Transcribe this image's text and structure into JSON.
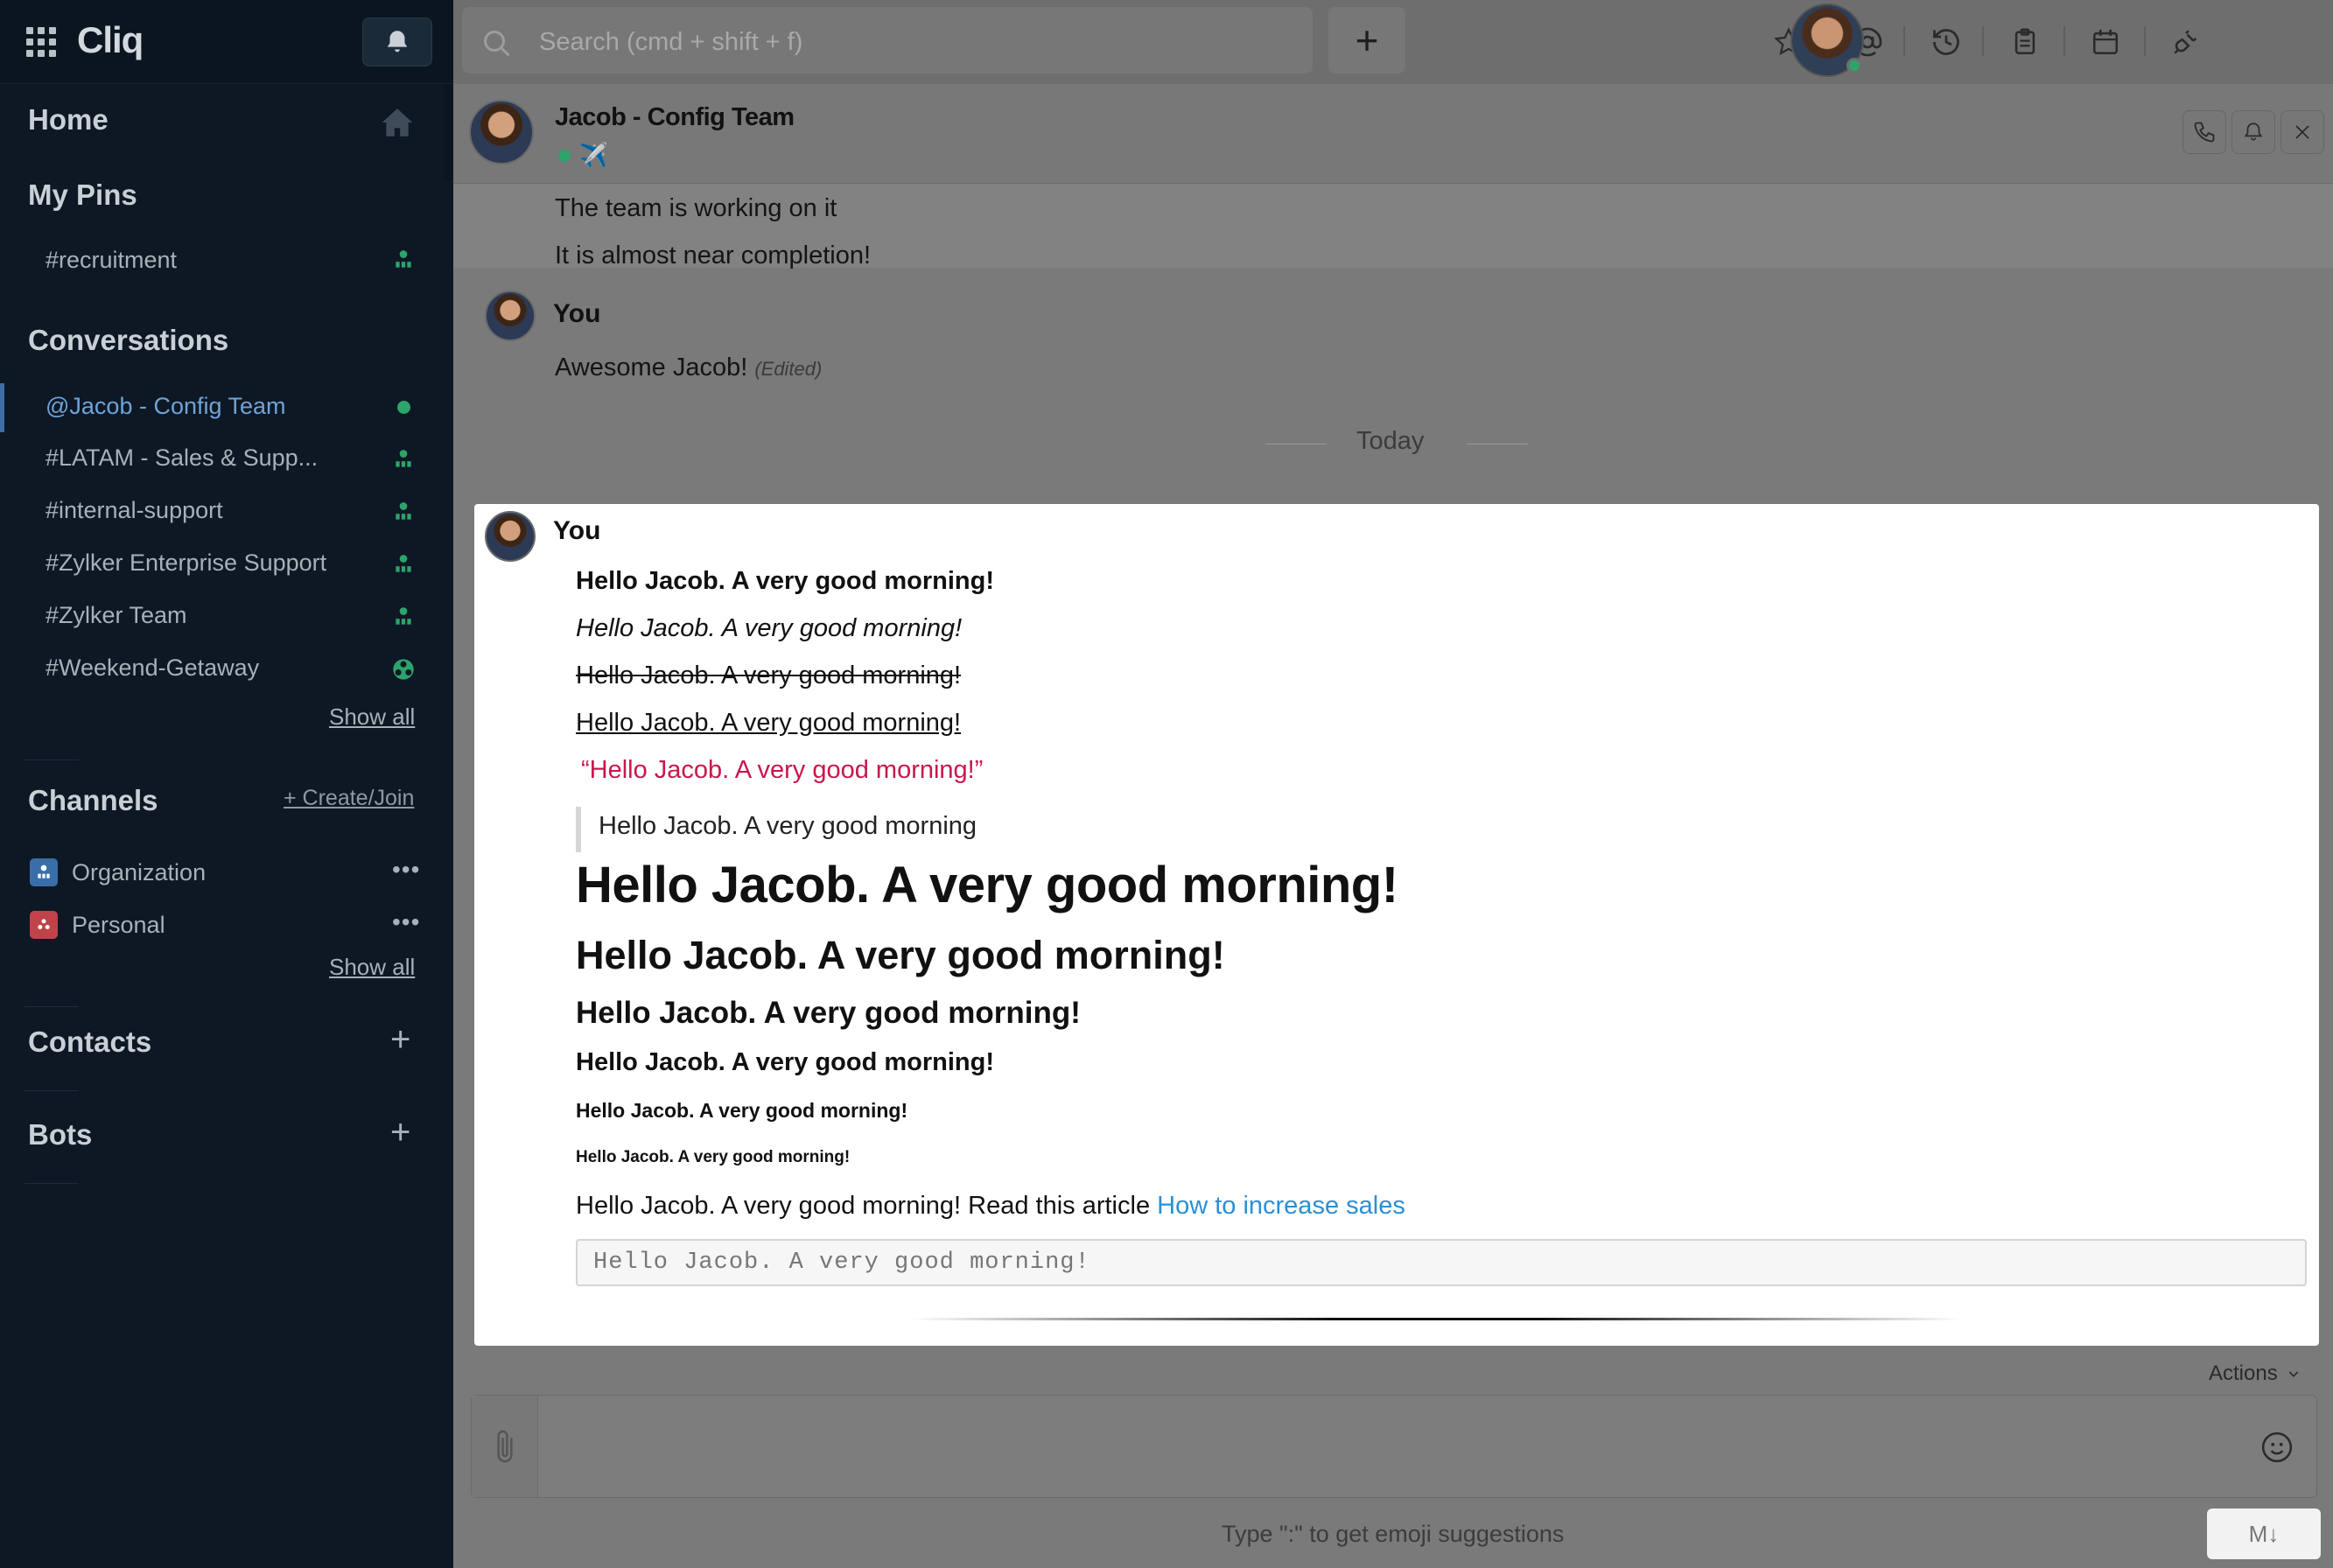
{
  "app": {
    "name": "Cliq"
  },
  "sidebar": {
    "home_label": "Home",
    "pins": {
      "title": "My Pins",
      "items": [
        {
          "label": "#recruitment",
          "icon": "org-icon"
        }
      ]
    },
    "conversations": {
      "title": "Conversations",
      "items": [
        {
          "label": "@Jacob - Config Team",
          "icon": "online-dot",
          "active": true
        },
        {
          "label": "#LATAM - Sales & Supp...",
          "icon": "org-icon"
        },
        {
          "label": "#internal-support",
          "icon": "org-icon"
        },
        {
          "label": "#Zylker Enterprise Support",
          "icon": "org-icon"
        },
        {
          "label": "#Zylker Team",
          "icon": "org-icon"
        },
        {
          "label": "#Weekend-Getaway",
          "icon": "personal-icon"
        }
      ],
      "show_all": "Show all"
    },
    "channels": {
      "title": "Channels",
      "create_join": "+ Create/Join",
      "items": [
        {
          "label": "Organization",
          "badge_color": "#3a6ea8"
        },
        {
          "label": "Personal",
          "badge_color": "#c0434a"
        }
      ],
      "show_all": "Show all"
    },
    "contacts_title": "Contacts",
    "bots_title": "Bots"
  },
  "topbar": {
    "search_placeholder": "Search (cmd + shift + f)",
    "add_label": "+",
    "icons": [
      "star-icon",
      "mention-icon",
      "history-icon",
      "clipboard-icon",
      "calendar-icon",
      "plug-icon"
    ]
  },
  "chat": {
    "contact_name": "Jacob - Config Team",
    "status_emoji": "✈️",
    "earlier_messages": [
      "The team is working on it",
      "It is almost near completion!"
    ],
    "you_label": "You",
    "reply_text": "Awesome Jacob!",
    "edited_label": "(Edited)",
    "date_divider": "Today",
    "formatted_message": {
      "sender": "You",
      "bold": "Hello Jacob. A very good morning!",
      "italic": "Hello Jacob. A very good morning!",
      "strike": "Hello Jacob. A very good morning!",
      "underline": "Hello Jacob. A very good morning!",
      "highlight": "“Hello Jacob. A very good morning!”",
      "blockquote": "Hello Jacob. A very good morning",
      "h1": "Hello Jacob. A very good morning!",
      "h2": "Hello Jacob. A very good morning!",
      "h3": "Hello Jacob. A very good morning!",
      "h4": "Hello Jacob. A very good morning!",
      "h5": "Hello Jacob. A very good morning!",
      "h6": "Hello Jacob. A very good morning!",
      "link_prefix": "Hello Jacob. A very good morning! Read this article ",
      "link_text": "How to increase sales",
      "code": "Hello Jacob. A very good morning!"
    },
    "highlight_color": "#c8174a",
    "link_color": "#2a8fd4"
  },
  "composer": {
    "actions_label": "Actions",
    "hint": "Type \":\" to get emoji suggestions",
    "markdown_label": "M↓"
  }
}
